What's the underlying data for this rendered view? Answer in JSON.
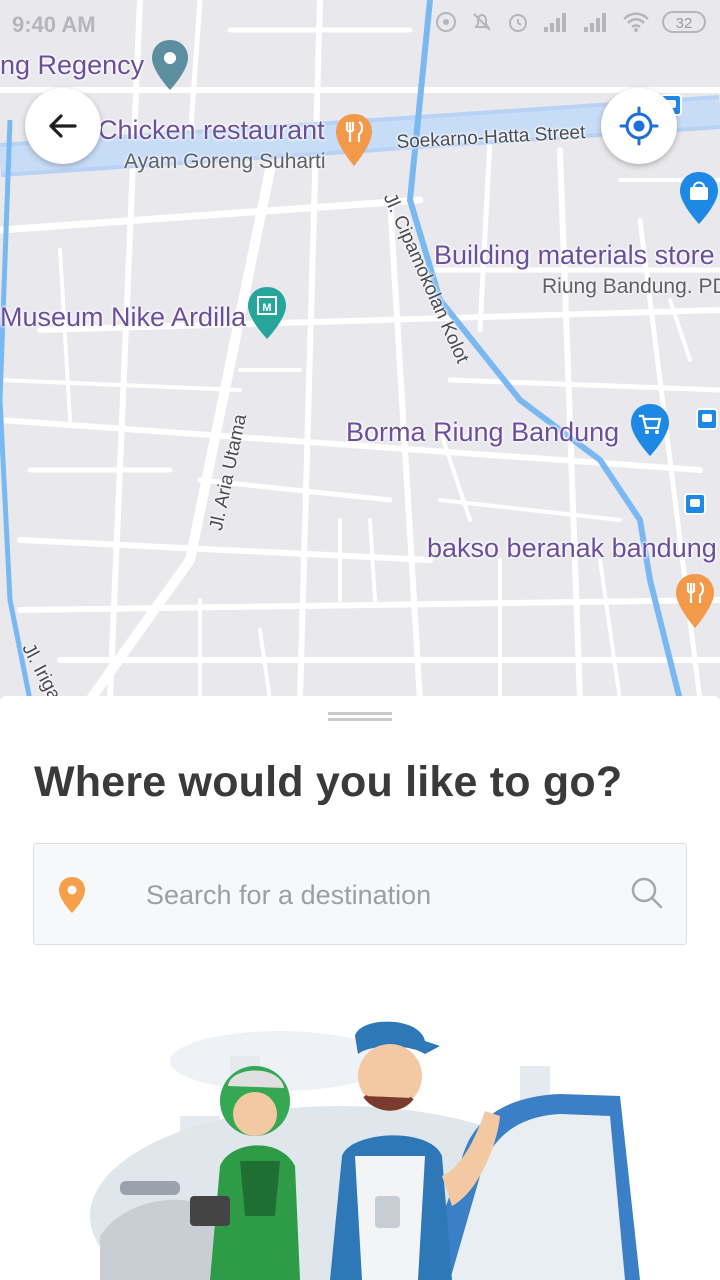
{
  "status_bar": {
    "time": "9:40 AM",
    "battery": "32"
  },
  "map": {
    "labels": {
      "regency": "ng Regency",
      "chicken_restaurant": "Chicken restaurant",
      "ayam_goreng": "Ayam Goreng Suharti",
      "soekarno_hatta": "Soekarno-Hatta Street",
      "building_materials": "Building materials store",
      "riung_bandung_pd": "Riung Bandung. PD",
      "museum": "Museum Nike Ardilla",
      "cipamokolan": "Jl. Cipamokolan Kolot",
      "borma": "Borma Riung Bandung",
      "aria_utama": "Jl. Aria Utama",
      "bakso": "bakso beranak bandung",
      "irigasi": "Jl. Iriga"
    },
    "colors": {
      "background": "#e8e8ed",
      "road": "#ffffff",
      "main_road": "#b7d2f5",
      "label": "#6b4f9c",
      "food_pin": "#f2994a",
      "museum_pin": "#26a69a",
      "shop_pin": "#1e88e5",
      "place_pin": "#5c8ea0"
    },
    "icons": [
      "back-arrow-icon",
      "my-location-icon"
    ]
  },
  "sheet": {
    "title": "Where would you like to go?",
    "search": {
      "placeholder": "Search for a destination",
      "value": ""
    },
    "colors": {
      "pin": "#f7a04b",
      "title": "#3a3a3a"
    }
  }
}
